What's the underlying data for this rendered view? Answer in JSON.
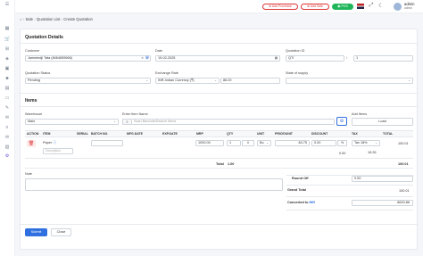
{
  "breadcrumb": {
    "home_icon": "home-icon",
    "items": [
      "Sale",
      "Quotation List",
      "Create Quotation"
    ]
  },
  "topbar": {
    "add_purchase": "Add Purchase",
    "add_sale": "Add Sale",
    "pos": "POS",
    "user_name": "admin",
    "user_role": "admin"
  },
  "details": {
    "title": "Quotation Details",
    "customer_label": "Customer",
    "customer_value": "Jamshedji Tata (8464659666)",
    "date_label": "Date",
    "date_value": "19-02-2025",
    "quotation_id_label": "Quotation ID",
    "quotation_prefix": "QT/",
    "quotation_number": "1",
    "status_label": "Quotation Status",
    "status_value": "Pending",
    "exchange_label": "Exchange Rate",
    "currency_value": "INR-Indian Currency (₹)",
    "rate_value": "86.20",
    "state_label": "State of supply"
  },
  "items": {
    "title": "Items",
    "warehouse_label": "Warehouse",
    "warehouse_value": "Main",
    "item_name_label": "Enter Item Name",
    "item_name_placeholder": "Scan Barcode/Search Items",
    "add_items_label": "Add Items",
    "load_button": "Load",
    "columns": [
      "ACTION",
      "ITEM",
      "SERIAL",
      "BATCH NO.",
      "MFG.DATE",
      "EXP.DATE",
      "MRP",
      "QTY",
      "UNIT",
      "PRICE/UNIT",
      "DISCOUNT",
      "TAX",
      "TOTAL"
    ],
    "row": {
      "item": "Paper",
      "description_placeholder": "Description",
      "mrp": "1000.00",
      "qty": "1",
      "unit": "Bo",
      "price": "84.75",
      "discount": "0.00",
      "discount_amount": "0.00",
      "tax": "Tax 18%",
      "tax_amount": "15.26",
      "total": "100.01"
    },
    "total_label": "Total",
    "total_qty": "1.00",
    "grand_sum": "100.01"
  },
  "summary": {
    "note_label": "Note",
    "round_off_label": "Round Off",
    "round_off_value": "0.00",
    "grand_total_label": "Grand Total",
    "grand_total_value": "100.01",
    "converted_label": "Converted to",
    "converted_currency": "INR",
    "converted_value": "8620.86"
  },
  "actions": {
    "submit": "Submit",
    "close": "Close"
  },
  "colors": {
    "accent": "#6c4fd8",
    "primary": "#2f6fe0",
    "danger": "#d33333",
    "success": "#1fb65a"
  }
}
